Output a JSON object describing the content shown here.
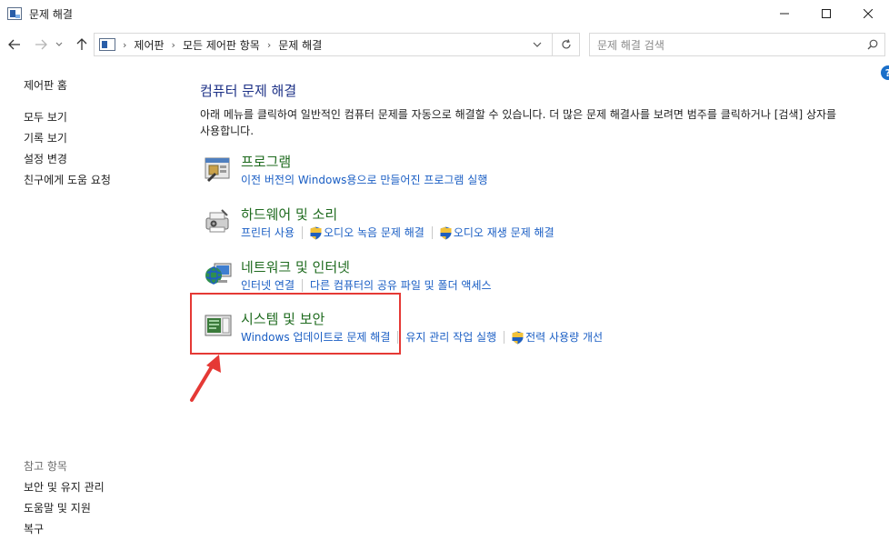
{
  "window": {
    "title": "문제 해결"
  },
  "address": {
    "crumbs": [
      "제어판",
      "모든 제어판 항목",
      "문제 해결"
    ]
  },
  "search": {
    "placeholder": "문제 해결 검색"
  },
  "sidebar": {
    "home": "제어판 홈",
    "links": [
      "모두 보기",
      "기록 보기",
      "설정 변경",
      "친구에게 도움 요청"
    ],
    "see_also_heading": "참고 항목",
    "see_also": [
      "보안 및 유지 관리",
      "도움말 및 지원",
      "복구"
    ]
  },
  "main": {
    "title": "컴퓨터 문제 해결",
    "desc_line1": "아래 메뉴를 클릭하여 일반적인 컴퓨터 문제를 자동으로 해결할 수 있습니다. 더 많은 문제 해결사를 보려면 범주를 클릭하거나 [검색] 상자를",
    "desc_line2": "사용합니다."
  },
  "categories": [
    {
      "title": "프로그램",
      "links": [
        "이전 버전의 Windows용으로 만들어진 프로그램 실행"
      ]
    },
    {
      "title": "하드웨어 및 소리",
      "links": [
        "프린터 사용",
        "오디오 녹음 문제 해결",
        "오디오 재생 문제 해결"
      ]
    },
    {
      "title": "네트워크 및 인터넷",
      "links": [
        "인터넷 연결",
        "다른 컴퓨터의 공유 파일 및 폴더 액세스"
      ]
    },
    {
      "title": "시스템 및 보안",
      "links": [
        "Windows 업데이트로 문제 해결",
        "유지 관리 작업 실행",
        "전력 사용량 개선"
      ]
    }
  ],
  "colors": {
    "link": "#1a5ec4",
    "category_title": "#1f6b1f",
    "heading": "#1e3287",
    "highlight": "#e53935"
  }
}
